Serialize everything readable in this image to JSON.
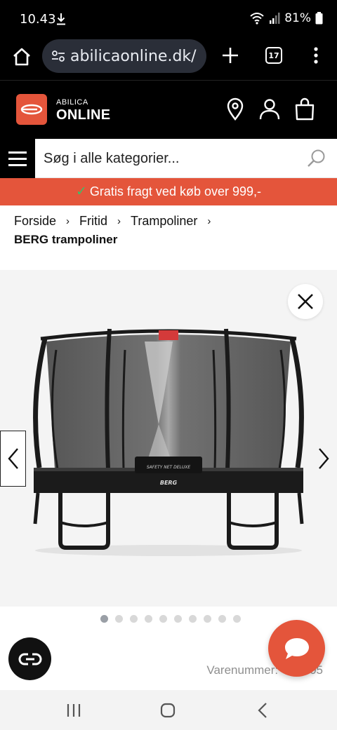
{
  "status_bar": {
    "time": "10.43",
    "battery": "81%",
    "icons": [
      "download-icon",
      "wifi-icon",
      "signal-icon",
      "battery-icon"
    ]
  },
  "browser": {
    "url": "abilicaonline.dk/",
    "tab_count": "17",
    "icons": [
      "home-icon",
      "site-settings-icon",
      "new-tab-icon",
      "tabs-icon",
      "overflow-menu-icon"
    ]
  },
  "header": {
    "logo_small": "ABILICA",
    "logo_big": "ONLINE",
    "icons": [
      "store-locator-icon",
      "account-icon",
      "cart-icon"
    ]
  },
  "search": {
    "placeholder": "Søg i alle kategorier..."
  },
  "promo": {
    "check": "✓",
    "text": "Gratis fragt ved køb over 999,-"
  },
  "breadcrumb": {
    "items": [
      "Forside",
      "Fritid",
      "Trampoliner"
    ],
    "separator": "›",
    "current": "BERG trampoliner"
  },
  "gallery": {
    "image_name": "BERG trampoline with safety net deluxe",
    "net_label": "SAFETY NET DELUXE",
    "brand": "BERG",
    "slide_count": 10,
    "active_slide": 1
  },
  "product": {
    "sku_label": "Varenummer: 4■■■05"
  },
  "colors": {
    "brand_orange": "#e4553b",
    "check_green": "#3bbf6a"
  }
}
